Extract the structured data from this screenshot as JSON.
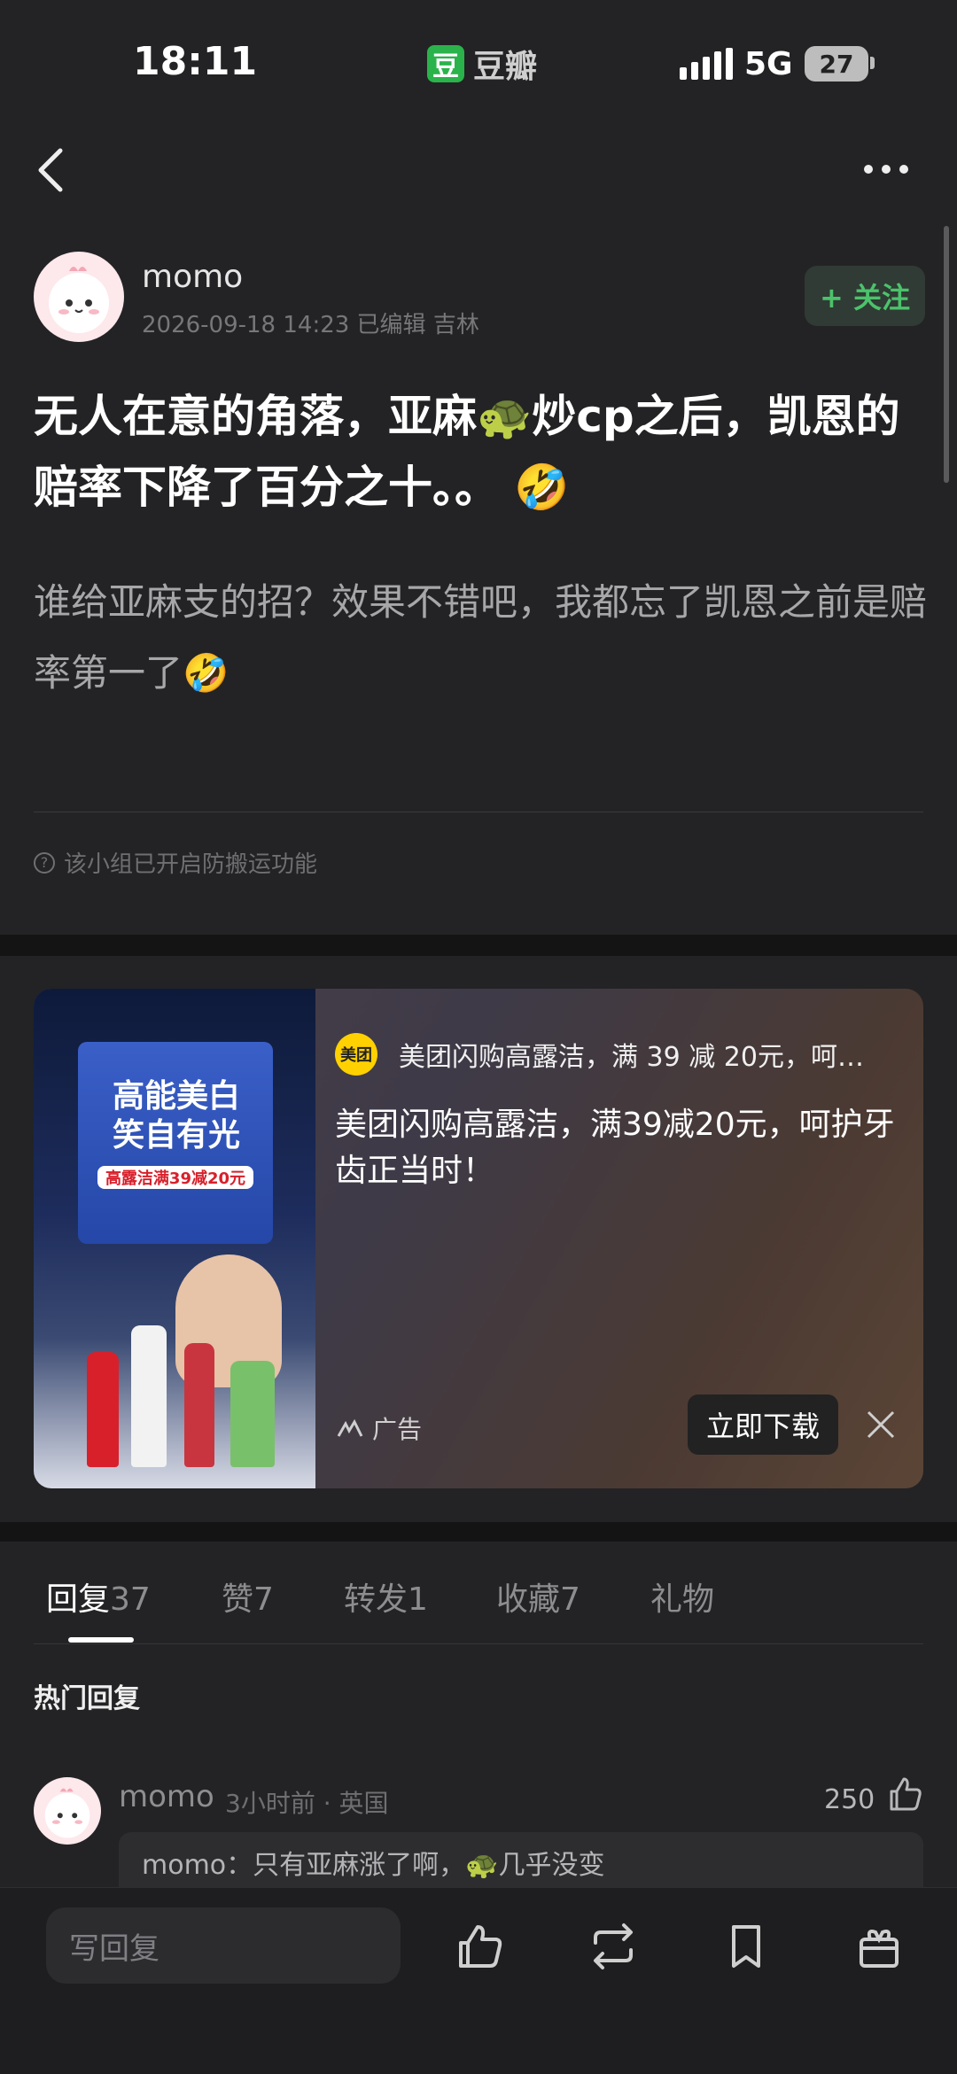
{
  "status_bar": {
    "time": "18:11",
    "app_badge": "豆",
    "app_name": "豆瓣",
    "network": "5G",
    "battery": "27"
  },
  "nav": {
    "back_icon": "chevron-left-icon",
    "more_icon": "more-dots-icon"
  },
  "post": {
    "author": "momo",
    "meta": "2026-09-18 14:23  已编辑  吉林",
    "follow_label": "+ 关注",
    "title": "无人在意的角落，亚麻🐢炒cp之后，凯恩的赔率下降了百分之十。。 🤣",
    "body": "谁给亚麻支的招？效果不错吧，我都忘了凯恩之前是赔率第一了🤣",
    "notice": "该小组已开启防搬运功能"
  },
  "ad": {
    "poster_title": "高能美白 笑自有光",
    "poster_tag": "高露洁满39减20元",
    "brand_logo_text": "美团",
    "source": "美团闪购高露洁，满 39 减 20元，呵…",
    "headline": "美团闪购高露洁，满39减20元，呵护牙齿正当时！",
    "label": "广告",
    "download_label": "立即下载",
    "close_icon": "close-icon"
  },
  "tabs": [
    {
      "label": "回复",
      "count": "37"
    },
    {
      "label": "赞",
      "count": "7"
    },
    {
      "label": "转发",
      "count": "1"
    },
    {
      "label": "收藏",
      "count": "7"
    },
    {
      "label": "礼物",
      "count": ""
    }
  ],
  "section_title": "热门回复",
  "reply": {
    "name": "momo",
    "meta": "3小时前 · 英国",
    "likes": "250",
    "quote": "momo：只有亚麻涨了啊，🐢几乎没变"
  },
  "bottom_bar": {
    "placeholder": "写回复",
    "icons": [
      "thumbs-up-icon",
      "repost-icon",
      "bookmark-icon",
      "gift-icon"
    ]
  },
  "colors": {
    "accent_green": "#4cc26b",
    "background": "#232325"
  }
}
